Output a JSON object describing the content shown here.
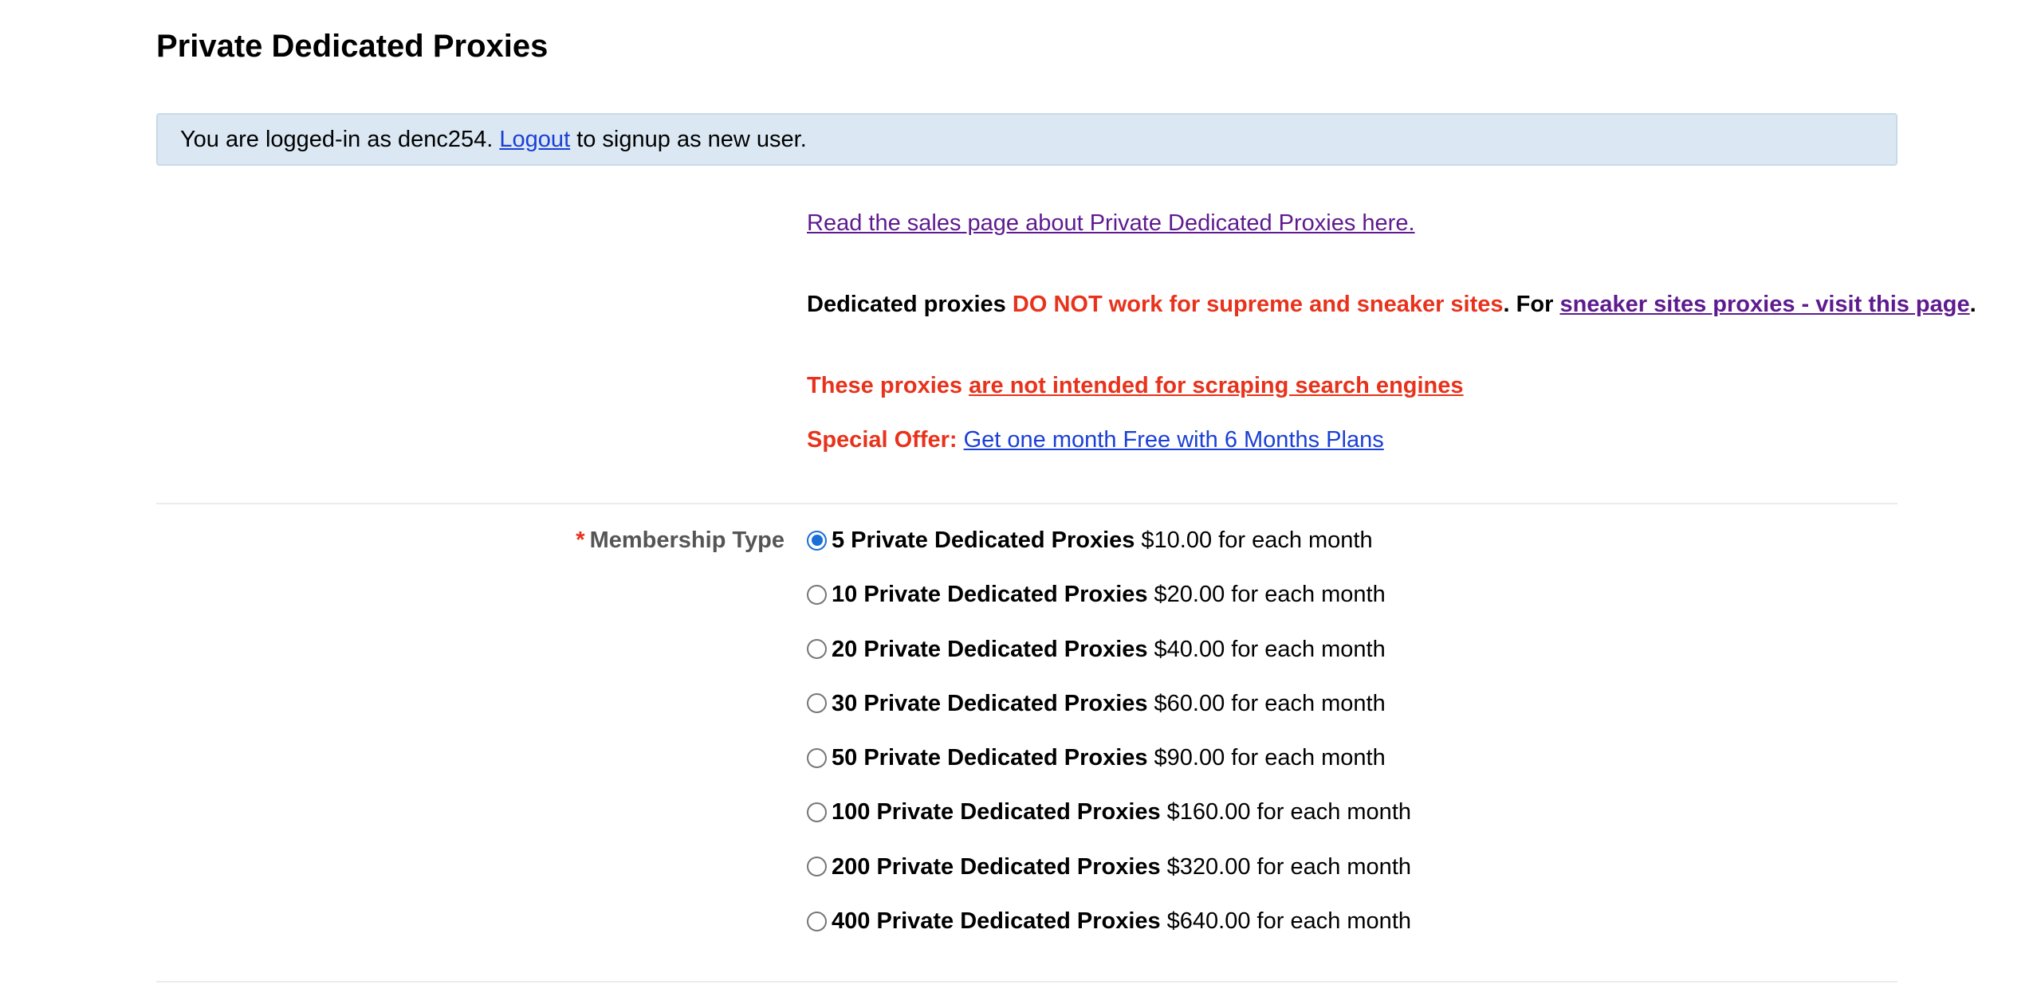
{
  "page": {
    "title": "Private Dedicated Proxies"
  },
  "login_notice": {
    "prefix": "You are logged-in as denc254.",
    "logout_label": "Logout",
    "suffix": "to signup as new user."
  },
  "info": {
    "sales_link": "Read the sales page about Private Dedicated Proxies here.",
    "warning": {
      "part1": "Dedicated proxies",
      "part2": "DO NOT work for supreme and sneaker sites",
      "part3": ". For",
      "link": "sneaker sites proxies - visit this page",
      "part4": "."
    },
    "scraping": {
      "part1": "These proxies",
      "link": "are not intended for scraping search engines"
    },
    "offer": {
      "label": "Special Offer:",
      "link": "Get one month Free with 6 Months Plans"
    }
  },
  "membership": {
    "required_marker": "*",
    "label": "Membership Type",
    "options": [
      {
        "qty": "5 Private Dedicated Proxies",
        "price": "$10.00 for each month",
        "selected": true
      },
      {
        "qty": "10 Private Dedicated Proxies",
        "price": "$20.00 for each month",
        "selected": false
      },
      {
        "qty": "20 Private Dedicated Proxies",
        "price": "$40.00 for each month",
        "selected": false
      },
      {
        "qty": "30 Private Dedicated Proxies",
        "price": "$60.00 for each month",
        "selected": false
      },
      {
        "qty": "50 Private Dedicated Proxies",
        "price": "$90.00 for each month",
        "selected": false
      },
      {
        "qty": "100 Private Dedicated Proxies",
        "price": "$160.00 for each month",
        "selected": false
      },
      {
        "qty": "200 Private Dedicated Proxies",
        "price": "$320.00 for each month",
        "selected": false
      },
      {
        "qty": "400 Private Dedicated Proxies",
        "price": "$640.00 for each month",
        "selected": false
      }
    ]
  },
  "colors": {
    "notice_bg": "#dbe8f3",
    "link_blue": "#1a3fd6",
    "link_visited": "#5e1a8e",
    "warning_red": "#e8321b",
    "radio_selected": "#1a6ed8"
  }
}
